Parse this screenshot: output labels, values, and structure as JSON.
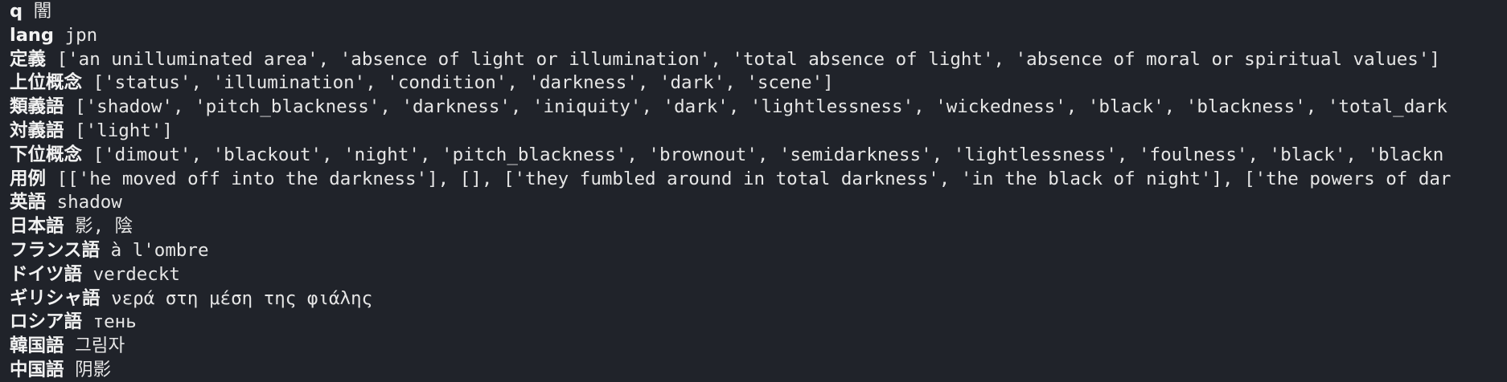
{
  "terminal": {
    "lines": [
      {
        "key": "q",
        "value": "闇"
      },
      {
        "key": "lang",
        "value": "jpn"
      },
      {
        "key": "定義",
        "value": "['an unilluminated area', 'absence of light or illumination', 'total absence of light', 'absence of moral or spiritual values']"
      },
      {
        "key": "上位概念",
        "value": "['status', 'illumination', 'condition', 'darkness', 'dark', 'scene']"
      },
      {
        "key": "類義語",
        "value": "['shadow', 'pitch_blackness', 'darkness', 'iniquity', 'dark', 'lightlessness', 'wickedness', 'black', 'blackness', 'total_dark"
      },
      {
        "key": "対義語",
        "value": "['light']"
      },
      {
        "key": "下位概念",
        "value": "['dimout', 'blackout', 'night', 'pitch_blackness', 'brownout', 'semidarkness', 'lightlessness', 'foulness', 'black', 'blackn"
      },
      {
        "key": "用例",
        "value": "[['he moved off into the darkness'], [], ['they fumbled around in total darkness', 'in the black of night'], ['the powers of dar"
      },
      {
        "key": "英語",
        "value": "shadow"
      },
      {
        "key": "日本語",
        "value": "影, 陰"
      },
      {
        "key": "フランス語",
        "value": "à l'ombre"
      },
      {
        "key": "ドイツ語",
        "value": "verdeckt"
      },
      {
        "key": "ギリシャ語",
        "value": "νερά στη μέση της φιάλης"
      },
      {
        "key": "ロシア語",
        "value": "тень"
      },
      {
        "key": "韓国語",
        "value": "그림자"
      },
      {
        "key": "中国語",
        "value": "阴影"
      }
    ]
  }
}
